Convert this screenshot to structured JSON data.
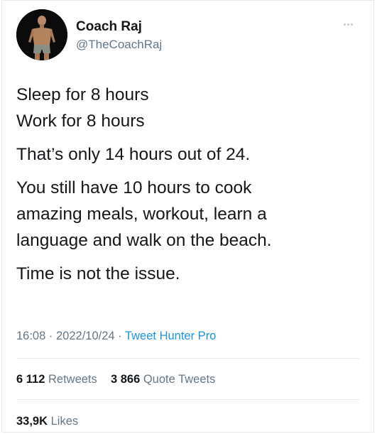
{
  "author": {
    "name": "Coach Raj",
    "handle": "@TheCoachRaj"
  },
  "tweet": {
    "paragraphs": [
      [
        "Sleep for 8 hours",
        "Work for 8 hours"
      ],
      [
        "That’s only 14 hours out of 24."
      ],
      [
        "You still have 10 hours to cook",
        "amazing meals, workout, learn a",
        "language and walk on the beach."
      ],
      [
        "Time is not the issue."
      ]
    ]
  },
  "meta": {
    "time": "16:08",
    "separator": "·",
    "date": "2022/10/24",
    "source": "Tweet Hunter Pro"
  },
  "stats": {
    "retweets_count": "6 112",
    "retweets_label": "Retweets",
    "quotes_count": "3 866",
    "quotes_label": "Quote Tweets",
    "likes_count": "33,9K",
    "likes_label": "Likes"
  },
  "icons": {
    "more": "more-horizontal-icon"
  },
  "colors": {
    "text": "#14171a",
    "secondary": "#657786",
    "link": "#1b95e0",
    "border": "#e6ecf0"
  }
}
